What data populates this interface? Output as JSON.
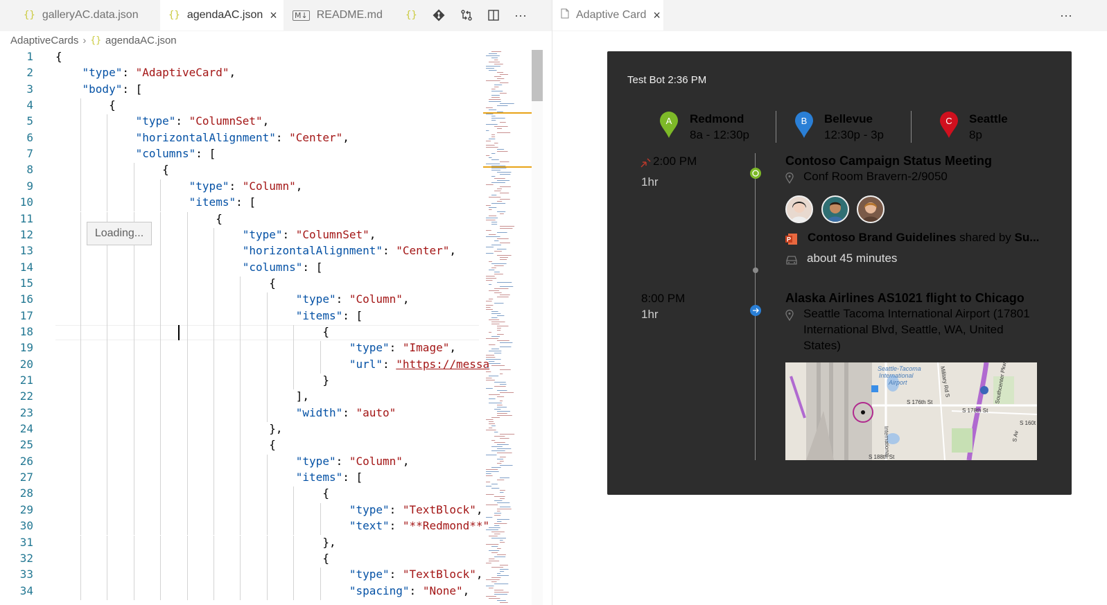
{
  "editor_tabs": [
    {
      "icon": "{}",
      "label": "galleryAC.data.json"
    },
    {
      "icon": "{}",
      "label": "agendaAC.json",
      "active": true
    },
    {
      "icon": "M↓",
      "label": "README.md"
    },
    {
      "icon": "{}",
      "label": ""
    }
  ],
  "breadcrumb": {
    "folder": "AdaptiveCards",
    "file": "agendaAC.json"
  },
  "loading_text": "Loading...",
  "code_lines": [
    [
      {
        "t": "{"
      }
    ],
    [
      {
        "t": "    "
      },
      {
        "t": "\"type\"",
        "c": "k"
      },
      {
        "t": ": "
      },
      {
        "t": "\"AdaptiveCard\"",
        "c": "s"
      },
      {
        "t": ","
      }
    ],
    [
      {
        "t": "    "
      },
      {
        "t": "\"body\"",
        "c": "k"
      },
      {
        "t": ": ["
      }
    ],
    [
      {
        "t": "        {"
      }
    ],
    [
      {
        "t": "            "
      },
      {
        "t": "\"type\"",
        "c": "k"
      },
      {
        "t": ": "
      },
      {
        "t": "\"ColumnSet\"",
        "c": "s"
      },
      {
        "t": ","
      }
    ],
    [
      {
        "t": "            "
      },
      {
        "t": "\"horizontalAlignment\"",
        "c": "k"
      },
      {
        "t": ": "
      },
      {
        "t": "\"Center\"",
        "c": "s"
      },
      {
        "t": ","
      }
    ],
    [
      {
        "t": "            "
      },
      {
        "t": "\"columns\"",
        "c": "k"
      },
      {
        "t": ": ["
      }
    ],
    [
      {
        "t": "                {"
      }
    ],
    [
      {
        "t": "                    "
      },
      {
        "t": "\"type\"",
        "c": "k"
      },
      {
        "t": ": "
      },
      {
        "t": "\"Column\"",
        "c": "s"
      },
      {
        "t": ","
      }
    ],
    [
      {
        "t": "                    "
      },
      {
        "t": "\"items\"",
        "c": "k"
      },
      {
        "t": ": ["
      }
    ],
    [
      {
        "t": "                        {"
      }
    ],
    [
      {
        "t": "                            "
      },
      {
        "t": "\"type\"",
        "c": "k"
      },
      {
        "t": ": "
      },
      {
        "t": "\"ColumnSet\"",
        "c": "s"
      },
      {
        "t": ","
      }
    ],
    [
      {
        "t": "                            "
      },
      {
        "t": "\"horizontalAlignment\"",
        "c": "k"
      },
      {
        "t": ": "
      },
      {
        "t": "\"Center\"",
        "c": "s"
      },
      {
        "t": ","
      }
    ],
    [
      {
        "t": "                            "
      },
      {
        "t": "\"columns\"",
        "c": "k"
      },
      {
        "t": ": ["
      }
    ],
    [
      {
        "t": "                                {"
      }
    ],
    [
      {
        "t": "                                    "
      },
      {
        "t": "\"type\"",
        "c": "k"
      },
      {
        "t": ": "
      },
      {
        "t": "\"Column\"",
        "c": "s"
      },
      {
        "t": ","
      }
    ],
    [
      {
        "t": "                                    "
      },
      {
        "t": "\"items\"",
        "c": "k"
      },
      {
        "t": ": ["
      }
    ],
    [
      {
        "t": "                                        {"
      }
    ],
    [
      {
        "t": "                                            "
      },
      {
        "t": "\"type\"",
        "c": "k"
      },
      {
        "t": ": "
      },
      {
        "t": "\"Image\"",
        "c": "s"
      },
      {
        "t": ","
      }
    ],
    [
      {
        "t": "                                            "
      },
      {
        "t": "\"url\"",
        "c": "k"
      },
      {
        "t": ": "
      },
      {
        "t": "\"https://messa",
        "c": "u"
      }
    ],
    [
      {
        "t": "                                        }"
      }
    ],
    [
      {
        "t": "                                    ],"
      }
    ],
    [
      {
        "t": "                                    "
      },
      {
        "t": "\"width\"",
        "c": "k"
      },
      {
        "t": ": "
      },
      {
        "t": "\"auto\"",
        "c": "s"
      }
    ],
    [
      {
        "t": "                                },"
      }
    ],
    [
      {
        "t": "                                {"
      }
    ],
    [
      {
        "t": "                                    "
      },
      {
        "t": "\"type\"",
        "c": "k"
      },
      {
        "t": ": "
      },
      {
        "t": "\"Column\"",
        "c": "s"
      },
      {
        "t": ","
      }
    ],
    [
      {
        "t": "                                    "
      },
      {
        "t": "\"items\"",
        "c": "k"
      },
      {
        "t": ": ["
      }
    ],
    [
      {
        "t": "                                        {"
      }
    ],
    [
      {
        "t": "                                            "
      },
      {
        "t": "\"type\"",
        "c": "k"
      },
      {
        "t": ": "
      },
      {
        "t": "\"TextBlock\"",
        "c": "s"
      },
      {
        "t": ","
      }
    ],
    [
      {
        "t": "                                            "
      },
      {
        "t": "\"text\"",
        "c": "k"
      },
      {
        "t": ": "
      },
      {
        "t": "\"**Redmond**\"",
        "c": "s"
      }
    ],
    [
      {
        "t": "                                        },"
      }
    ],
    [
      {
        "t": "                                        {"
      }
    ],
    [
      {
        "t": "                                            "
      },
      {
        "t": "\"type\"",
        "c": "k"
      },
      {
        "t": ": "
      },
      {
        "t": "\"TextBlock\"",
        "c": "s"
      },
      {
        "t": ","
      }
    ],
    [
      {
        "t": "                                            "
      },
      {
        "t": "\"spacing\"",
        "c": "k"
      },
      {
        "t": ": "
      },
      {
        "t": "\"None\"",
        "c": "s"
      },
      {
        "t": ","
      }
    ]
  ],
  "preview_tab": {
    "label": "Adaptive Card"
  },
  "card": {
    "sender": "Test Bot 2:36 PM",
    "locations": [
      {
        "letter": "A",
        "name": "Redmond",
        "time": "8a - 12:30p",
        "color": "#7db928"
      },
      {
        "letter": "B",
        "name": "Bellevue",
        "time": "12:30p - 3p",
        "color": "#2a7fd6"
      },
      {
        "letter": "C",
        "name": "Seattle",
        "time": "8p",
        "color": "#d0101e"
      }
    ],
    "event1": {
      "time": "2:00 PM",
      "duration": "1hr",
      "title": "Contoso Campaign Status Meeting",
      "location": "Conf Room Bravern-2/9050",
      "doc_title": "Contoso Brand Guidelines",
      "doc_shared": " shared by ",
      "doc_by": "Su...",
      "travel": "about 45 minutes"
    },
    "event2": {
      "time": "8:00 PM",
      "duration": "1hr",
      "title": "Alaska Airlines AS1021 flight to Chicago",
      "location_lines": [
        "Seattle Tacoma International Airport (17801",
        "International Blvd, Seattle, WA, United",
        "States)"
      ]
    },
    "map_labels": {
      "airport": [
        "Seattle-Tacoma",
        "International",
        "Airport"
      ],
      "st176": "S 176th St",
      "st178": "S 178th St",
      "st188": "S 188th St",
      "military": "Military Rd S",
      "intl": "International",
      "s160": "S 160t",
      "pkwy": "Southcenter Pkwy",
      "ave": "S Av"
    }
  }
}
